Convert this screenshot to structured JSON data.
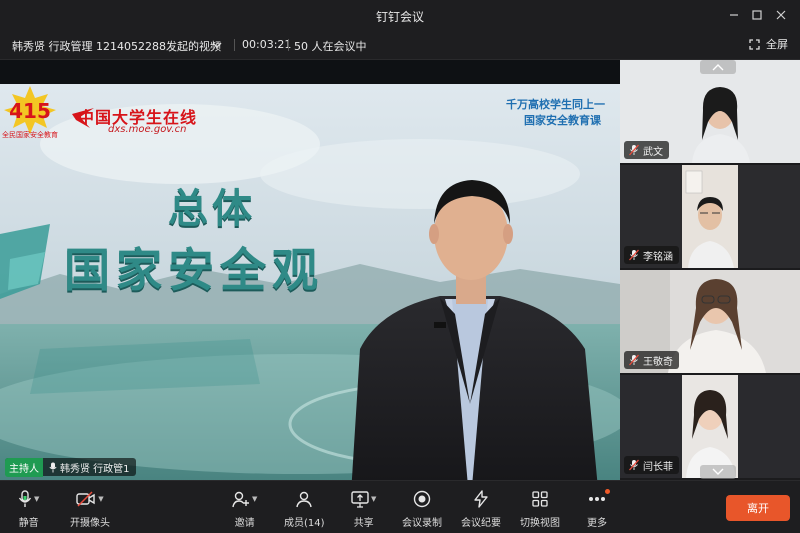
{
  "window": {
    "title": "钉钉会议"
  },
  "info": {
    "meeting_title": "韩秀贤 行政管理 1214052288发起的视频",
    "duration": "00:03:21",
    "participants_count": "50 人在会议中",
    "fullscreen_label": "全屏"
  },
  "stage": {
    "brand_logo_text": "中国大学生在线",
    "brand_url": "dxs.moe.gov.cn",
    "badge_number": "415",
    "badge_caption": "全民国家安全教育",
    "corner_line1": "千万高校学生同上一",
    "corner_line2": "国家安全教育课",
    "headline1": "总体",
    "headline2": "国家安全观",
    "host_tag": "主持人",
    "host_name": "韩秀贤 行政管1"
  },
  "participants": [
    {
      "name": "武文"
    },
    {
      "name": "李铭涵"
    },
    {
      "name": "王敬奇"
    },
    {
      "name": "闫长菲"
    }
  ],
  "toolbar": {
    "mute": "静音",
    "camera": "开摄像头",
    "invite": "邀请",
    "members": "成员(14)",
    "share": "共享",
    "record": "会议录制",
    "minutes": "会议纪要",
    "switch_view": "切换视图",
    "more": "更多",
    "leave": "离开"
  },
  "colors": {
    "accent_leave": "#e8562a",
    "host_tag": "#1f9b52",
    "headline_teal": "#2f8a87"
  }
}
